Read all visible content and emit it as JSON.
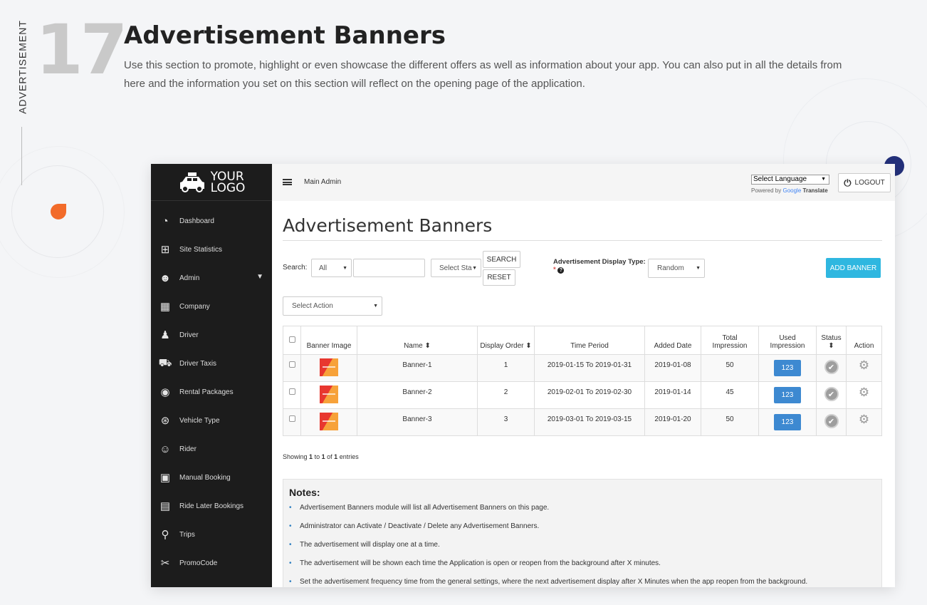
{
  "side_label": "ADVERTISEMENT",
  "section_number": "17",
  "title": "Advertisement Banners",
  "description": "Use this section to promote, highlight or even showcase the different offers as well as information about your app. You can also put in all the details from here and the information you set on this section will reflect on the opening page of the application.",
  "logo": {
    "line1": "YOUR",
    "line2": "LOGO"
  },
  "sidebar": {
    "items": [
      {
        "label": "Dashboard",
        "icon": "dashboard-icon"
      },
      {
        "label": "Site Statistics",
        "icon": "sitemap-icon"
      },
      {
        "label": "Admin",
        "icon": "admin-users-icon"
      },
      {
        "label": "Company",
        "icon": "building-icon"
      },
      {
        "label": "Driver",
        "icon": "driver-icon"
      },
      {
        "label": "Driver Taxis",
        "icon": "taxi-icon"
      },
      {
        "label": "Rental Packages",
        "icon": "dot-circle-icon"
      },
      {
        "label": "Vehicle Type",
        "icon": "steering-wheel-icon"
      },
      {
        "label": "Rider",
        "icon": "riders-icon"
      },
      {
        "label": "Manual Booking",
        "icon": "manual-booking-icon"
      },
      {
        "label": "Ride Later Bookings",
        "icon": "ride-later-icon"
      },
      {
        "label": "Trips",
        "icon": "trips-icon"
      },
      {
        "label": "PromoCode",
        "icon": "promocode-icon"
      }
    ]
  },
  "topbar": {
    "user": "Main Admin",
    "language_select": "Select Language",
    "powered_by": "Powered by",
    "google": "Google",
    "translate": "Translate",
    "logout": "LOGOUT"
  },
  "content": {
    "title": "Advertisement Banners",
    "search_label": "Search:",
    "search_scope": "All",
    "search_value": "",
    "status_select": "Select Sta",
    "search_button": "SEARCH",
    "reset_button": "RESET",
    "display_type_label": "Advertisement Display Type:",
    "required_mark": "*",
    "help_mark": "?",
    "display_type_value": "Random",
    "add_button": "ADD BANNER",
    "select_action": "Select Action"
  },
  "table": {
    "headers": [
      "Banner Image",
      "Name",
      "Display Order",
      "Time Period",
      "Added Date",
      "Total Impression",
      "Used Impression",
      "Status",
      "Action"
    ],
    "rows": [
      {
        "name": "Banner-1",
        "order": "1",
        "period": "2019-01-15 To 2019-01-31",
        "added": "2019-01-08",
        "total": "50",
        "used": "123"
      },
      {
        "name": "Banner-2",
        "order": "2",
        "period": "2019-02-01 To 2019-02-30",
        "added": "2019-01-14",
        "total": "45",
        "used": "123"
      },
      {
        "name": "Banner-3",
        "order": "3",
        "period": "2019-03-01 To 2019-03-15",
        "added": "2019-01-20",
        "total": "50",
        "used": "123"
      }
    ]
  },
  "showing": {
    "prefix": "Showing",
    "from": "1",
    "to_word": "to",
    "to": "1",
    "of_word": "of",
    "total": "1",
    "suffix": "entries"
  },
  "notes": {
    "title": "Notes:",
    "items": [
      "Advertisement Banners module will list all Advertisement Banners on this page.",
      "Administrator can Activate / Deactivate / Delete any Advertisement Banners.",
      "The advertisement will display one at a time.",
      "The advertisement will be shown each time the Application is open or reopen from the background after X minutes.",
      "Set the advertisement frequency time from the general settings, where the next advertisement display after X Minutes when the app reopen from the background."
    ]
  },
  "colors": {
    "accent": "#2fb7e0",
    "impression_button": "#3d89d1",
    "sidebar": "#1c1c1c",
    "deco_orange": "#f26b2a",
    "deco_navy": "#23307a"
  }
}
